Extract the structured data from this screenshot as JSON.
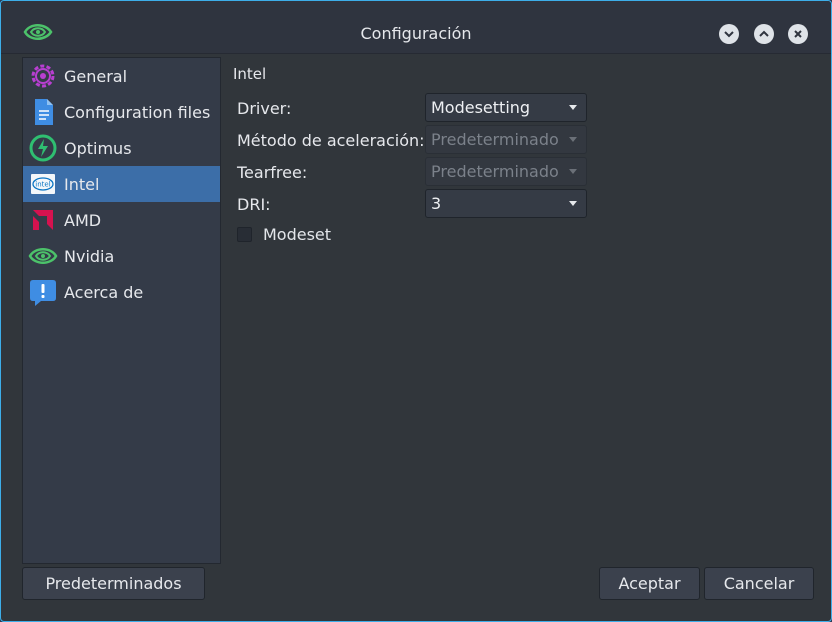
{
  "window": {
    "title": "Configuración",
    "controls": [
      "minimize",
      "maximize",
      "close"
    ]
  },
  "sidebar": {
    "items": [
      {
        "label": "General",
        "icon": "gear-icon",
        "color": "#b83fd1",
        "selected": false
      },
      {
        "label": "Configuration files",
        "icon": "document-icon",
        "color": "#3f8de3",
        "selected": false
      },
      {
        "label": "Optimus",
        "icon": "lightning-icon",
        "color": "#2fbf71",
        "selected": false
      },
      {
        "label": "Intel",
        "icon": "intel-icon",
        "color": "#0a75c4",
        "selected": true
      },
      {
        "label": "AMD",
        "icon": "amd-icon",
        "color": "#d6124f",
        "selected": false
      },
      {
        "label": "Nvidia",
        "icon": "nvidia-icon",
        "color": "#4cc26a",
        "selected": false
      },
      {
        "label": "Acerca de",
        "icon": "info-bubble-icon",
        "color": "#3f8de3",
        "selected": false
      }
    ]
  },
  "panel": {
    "title": "Intel",
    "driver": {
      "label": "Driver:",
      "value": "Modesetting",
      "enabled": true
    },
    "accel": {
      "label": "Método de aceleración:",
      "value": "Predeterminado",
      "enabled": false
    },
    "tearfree": {
      "label": "Tearfree:",
      "value": "Predeterminado",
      "enabled": false
    },
    "dri": {
      "label": "DRI:",
      "value": "3",
      "enabled": true
    },
    "modeset": {
      "label": "Modeset",
      "checked": false
    }
  },
  "footer": {
    "defaults_label": "Predeterminados",
    "accept_label": "Aceptar",
    "cancel_label": "Cancelar"
  },
  "colors": {
    "accent": "#3daee9",
    "selection": "#3c6ea8"
  }
}
